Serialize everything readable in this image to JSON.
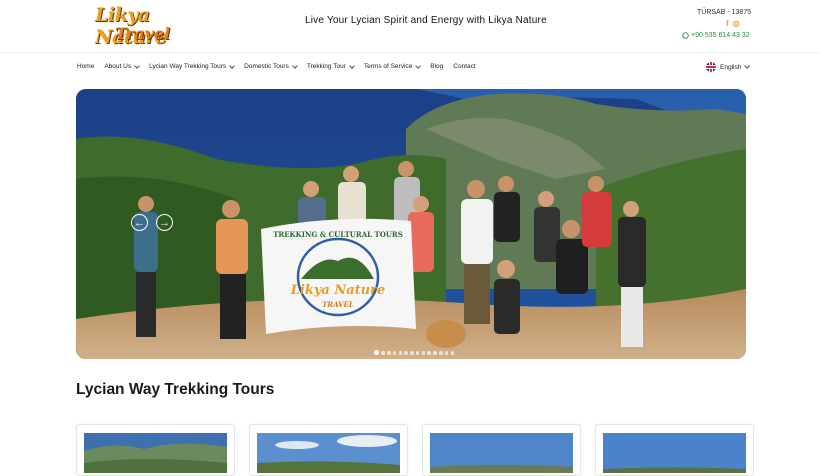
{
  "header": {
    "logo_line1": "Likya Nature",
    "logo_line2": "Travel",
    "tagline": "Live Your Lycian Spirit and Energy with Likya Nature",
    "license": "TÜRSAB - 13875",
    "phone": "+90 535 614 43 32",
    "social": [
      {
        "icon": "facebook-icon",
        "glyph": "f"
      },
      {
        "icon": "instagram-icon",
        "glyph": "◎"
      }
    ],
    "phone_icon": "whatsapp-icon"
  },
  "nav": {
    "items": [
      {
        "label": "Home",
        "dropdown": false
      },
      {
        "label": "About Us",
        "dropdown": true
      },
      {
        "label": "Lycian Way Trekking Tours",
        "dropdown": true
      },
      {
        "label": "Domestic Tours",
        "dropdown": true
      },
      {
        "label": "Trekking Tour",
        "dropdown": true
      },
      {
        "label": "Terms of Service",
        "dropdown": true
      },
      {
        "label": "Blog",
        "dropdown": false
      },
      {
        "label": "Contact",
        "dropdown": false
      }
    ],
    "language": "English"
  },
  "hero": {
    "banner_line1": "TREKKING & CULTURAL TOURS",
    "banner_line2": "Likya Nature",
    "banner_line3": "TRAVEL",
    "prev_icon": "arrow-left-icon",
    "next_icon": "arrow-right-icon",
    "slide_count": 14,
    "active_slide": 1
  },
  "main": {
    "section_title": "Lycian Way Trekking Tours"
  },
  "colors": {
    "brand_orange": "#f0a020",
    "phone_green": "#2a8a4a"
  }
}
